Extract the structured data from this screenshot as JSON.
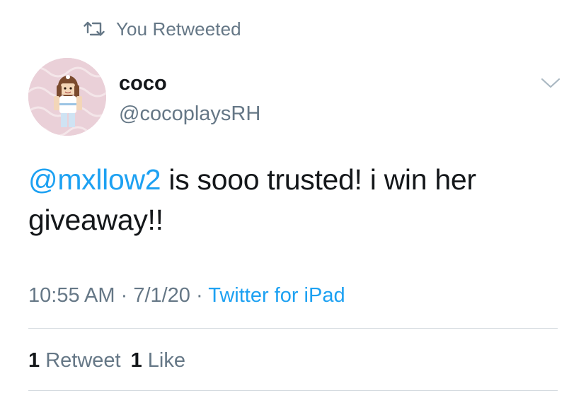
{
  "retweet_banner": {
    "icon": "retweet-icon",
    "label": "You Retweeted"
  },
  "author": {
    "avatar": "profile-avatar",
    "display_name": "coco",
    "handle": "@cocoplaysRH",
    "menu_icon": "chevron-down-icon"
  },
  "tweet": {
    "mention": "@mxllow2",
    "text_rest": " is sooo trusted! i win her giveaway!!"
  },
  "meta": {
    "time": "10:55 AM",
    "separator1": " · ",
    "date": "7/1/20",
    "separator2": " · ",
    "source": "Twitter for iPad"
  },
  "stats": {
    "retweet_count": "1",
    "retweet_label": "Retweet",
    "like_count": "1",
    "like_label": "Like"
  },
  "colors": {
    "accent": "#1da1f2",
    "secondary_text": "#657786",
    "primary_text": "#14171a",
    "divider": "#d5dbe0"
  }
}
